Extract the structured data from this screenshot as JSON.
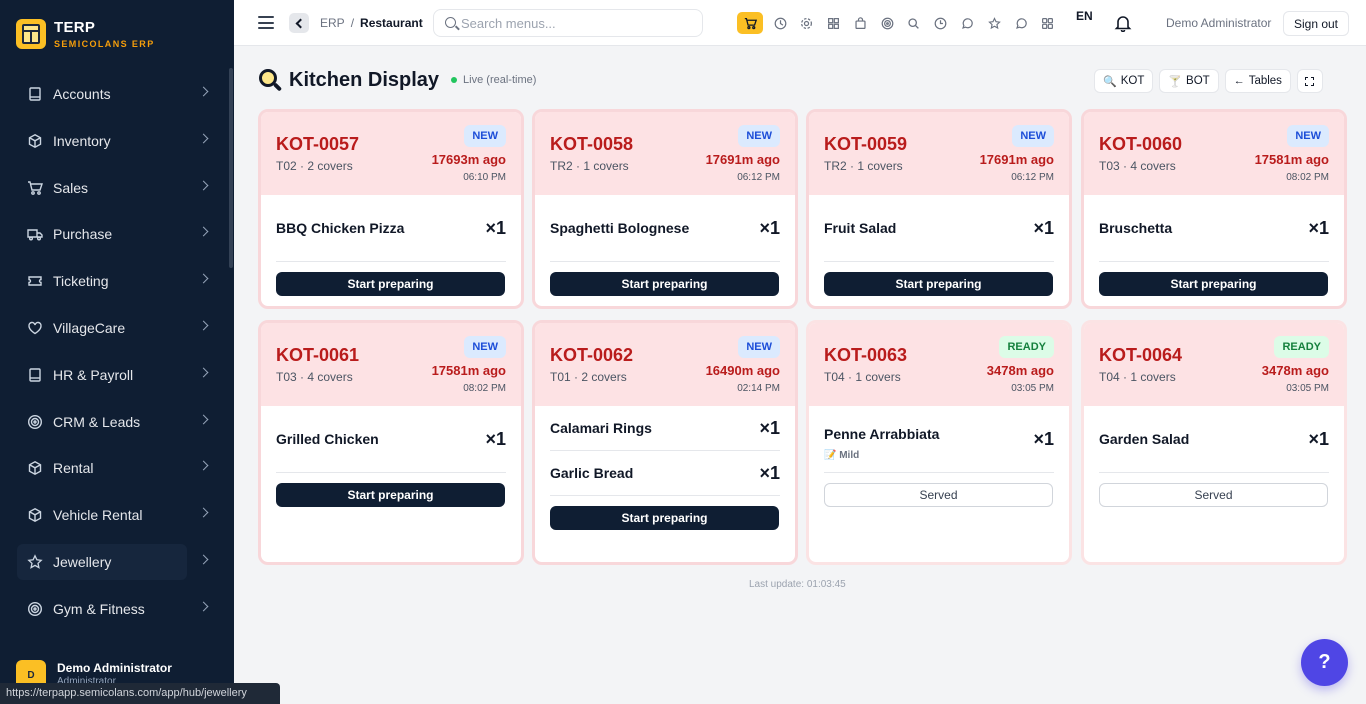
{
  "brand": {
    "title": "TERP",
    "subtitle": "SEMICOLANS ERP"
  },
  "sidebar": {
    "items": [
      {
        "label": "Accounts",
        "icon": "book-icon"
      },
      {
        "label": "Inventory",
        "icon": "box-icon"
      },
      {
        "label": "Sales",
        "icon": "cart-icon"
      },
      {
        "label": "Purchase",
        "icon": "truck-icon"
      },
      {
        "label": "Ticketing",
        "icon": "ticket-icon"
      },
      {
        "label": "VillageCare",
        "icon": "heart-icon"
      },
      {
        "label": "HR & Payroll",
        "icon": "book-icon"
      },
      {
        "label": "CRM & Leads",
        "icon": "target-icon"
      },
      {
        "label": "Rental",
        "icon": "box-icon"
      },
      {
        "label": "Vehicle Rental",
        "icon": "box-icon"
      },
      {
        "label": "Jewellery",
        "icon": "star-icon",
        "active": true
      },
      {
        "label": "Gym & Fitness",
        "icon": "target-icon"
      }
    ],
    "user": {
      "initial": "D",
      "name": "Demo Administrator",
      "role": "Administrator"
    }
  },
  "statusbar": {
    "url": "https://terpapp.semicolans.com/app/hub/jewellery"
  },
  "topbar": {
    "breadcrumb": [
      "ERP",
      "Restaurant"
    ],
    "search_placeholder": "Search menus...",
    "lang": "EN",
    "user": "Demo Administrator",
    "signout": "Sign out"
  },
  "page": {
    "title": "Kitchen Display",
    "live": "Live (real-time)",
    "buttons": {
      "kot": "KOT",
      "bot": "BOT",
      "tables": "Tables"
    },
    "last_update": "Last update: 01:03:45"
  },
  "colors": {
    "accent": "#fbbf24",
    "sidebar": "#0f1e33",
    "kot_red": "#b91c1c",
    "fab": "#4f46e5"
  },
  "cards": [
    {
      "kot": "KOT-0057",
      "meta": "T02 · 2 covers",
      "status": "NEW",
      "ago": "17693m ago",
      "time": "06:10 PM",
      "items": [
        {
          "name": "BBQ Chicken Pizza",
          "qty": "×1"
        }
      ],
      "action": "Start preparing"
    },
    {
      "kot": "KOT-0058",
      "meta": "TR2 · 1 covers",
      "status": "NEW",
      "ago": "17691m ago",
      "time": "06:12 PM",
      "items": [
        {
          "name": "Spaghetti Bolognese",
          "qty": "×1"
        }
      ],
      "action": "Start preparing"
    },
    {
      "kot": "KOT-0059",
      "meta": "TR2 · 1 covers",
      "status": "NEW",
      "ago": "17691m ago",
      "time": "06:12 PM",
      "items": [
        {
          "name": "Fruit Salad",
          "qty": "×1"
        }
      ],
      "action": "Start preparing"
    },
    {
      "kot": "KOT-0060",
      "meta": "T03 · 4 covers",
      "status": "NEW",
      "ago": "17581m ago",
      "time": "08:02 PM",
      "items": [
        {
          "name": "Bruschetta",
          "qty": "×1"
        }
      ],
      "action": "Start preparing"
    },
    {
      "kot": "KOT-0061",
      "meta": "T03 · 4 covers",
      "status": "NEW",
      "ago": "17581m ago",
      "time": "08:02 PM",
      "items": [
        {
          "name": "Grilled Chicken",
          "qty": "×1"
        }
      ],
      "action": "Start preparing"
    },
    {
      "kot": "KOT-0062",
      "meta": "T01 · 2 covers",
      "status": "NEW",
      "ago": "16490m ago",
      "time": "02:14 PM",
      "items": [
        {
          "name": "Calamari Rings",
          "qty": "×1"
        },
        {
          "name": "Garlic Bread",
          "qty": "×1"
        }
      ],
      "action": "Start preparing"
    },
    {
      "kot": "KOT-0063",
      "meta": "T04 · 1 covers",
      "status": "READY",
      "ago": "3478m ago",
      "time": "03:05 PM",
      "items": [
        {
          "name": "Penne Arrabbiata",
          "qty": "×1",
          "note": "📝 Mild"
        }
      ],
      "action": "Served"
    },
    {
      "kot": "KOT-0064",
      "meta": "T04 · 1 covers",
      "status": "READY",
      "ago": "3478m ago",
      "time": "03:05 PM",
      "items": [
        {
          "name": "Garden Salad",
          "qty": "×1"
        }
      ],
      "action": "Served"
    }
  ],
  "help": {
    "label": "?"
  }
}
